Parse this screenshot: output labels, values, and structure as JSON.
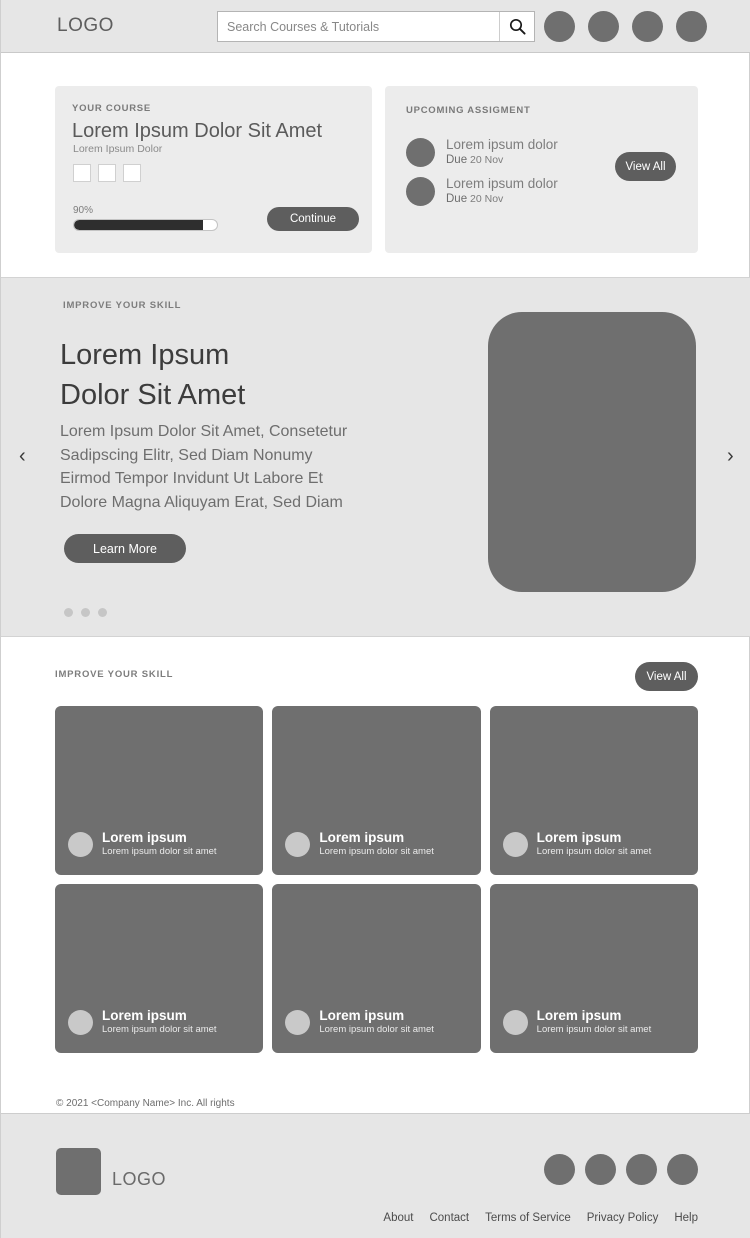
{
  "header": {
    "logo": "LOGO",
    "search": {
      "placeholder": "Search Courses & Tutorials",
      "value": "",
      "icon": "search-icon"
    },
    "avatar_count": 4
  },
  "course_card": {
    "eyebrow": "YOUR COURSE",
    "title": "Lorem Ipsum Dolor Sit Amet",
    "subtitle": "Lorem Ipsum Dolor",
    "checkbox_count": 3,
    "progress_label": "90%",
    "progress_percent": 90,
    "continue_label": "Continue"
  },
  "assignment_card": {
    "eyebrow": "UPCOMING  ASSIGMENT",
    "view_all_label": "View All",
    "items": [
      {
        "name": "Lorem ipsum dolor",
        "due_word": "Due",
        "due_date": "20 Nov"
      },
      {
        "name": "Lorem ipsum dolor",
        "due_word": "Due",
        "due_date": "20 Nov"
      }
    ]
  },
  "hero": {
    "eyebrow": "IMPROVE YOUR SKILL",
    "title": "Lorem Ipsum\nDolor Sit Amet",
    "body": "Lorem Ipsum Dolor Sit Amet, Consetetur\nSadipscing Elitr, Sed Diam Nonumy\nEirmod Tempor Invidunt Ut Labore Et\nDolore Magna Aliquyam Erat, Sed Diam",
    "cta_label": "Learn More",
    "prev_icon": "‹",
    "next_icon": "›",
    "dot_count": 3,
    "active_dot": 0
  },
  "skills": {
    "eyebrow": "IMPROVE YOUR SKILL",
    "view_all_label": "View All",
    "cards": [
      {
        "title": "Lorem ipsum",
        "subtitle": "Lorem ipsum dolor sit amet"
      },
      {
        "title": "Lorem ipsum",
        "subtitle": "Lorem ipsum dolor sit amet"
      },
      {
        "title": "Lorem ipsum",
        "subtitle": "Lorem ipsum dolor sit amet"
      },
      {
        "title": "Lorem ipsum",
        "subtitle": "Lorem ipsum dolor sit amet"
      },
      {
        "title": "Lorem ipsum",
        "subtitle": "Lorem ipsum dolor sit amet"
      },
      {
        "title": "Lorem ipsum",
        "subtitle": "Lorem ipsum dolor sit amet"
      }
    ]
  },
  "footer": {
    "logo": "LOGO",
    "copyright": "© 2021 <Company Name> Inc. All rights",
    "social_count": 4,
    "links": [
      "About",
      "Contact",
      "Terms of Service",
      "Privacy Policy",
      "Help"
    ]
  },
  "colors": {
    "band": "#e6e6e6",
    "card_panel": "#ececec",
    "placeholder_grey": "#6f6f6f",
    "button_dark": "#5e5e5e",
    "progress_fill": "#2e2e2e"
  }
}
